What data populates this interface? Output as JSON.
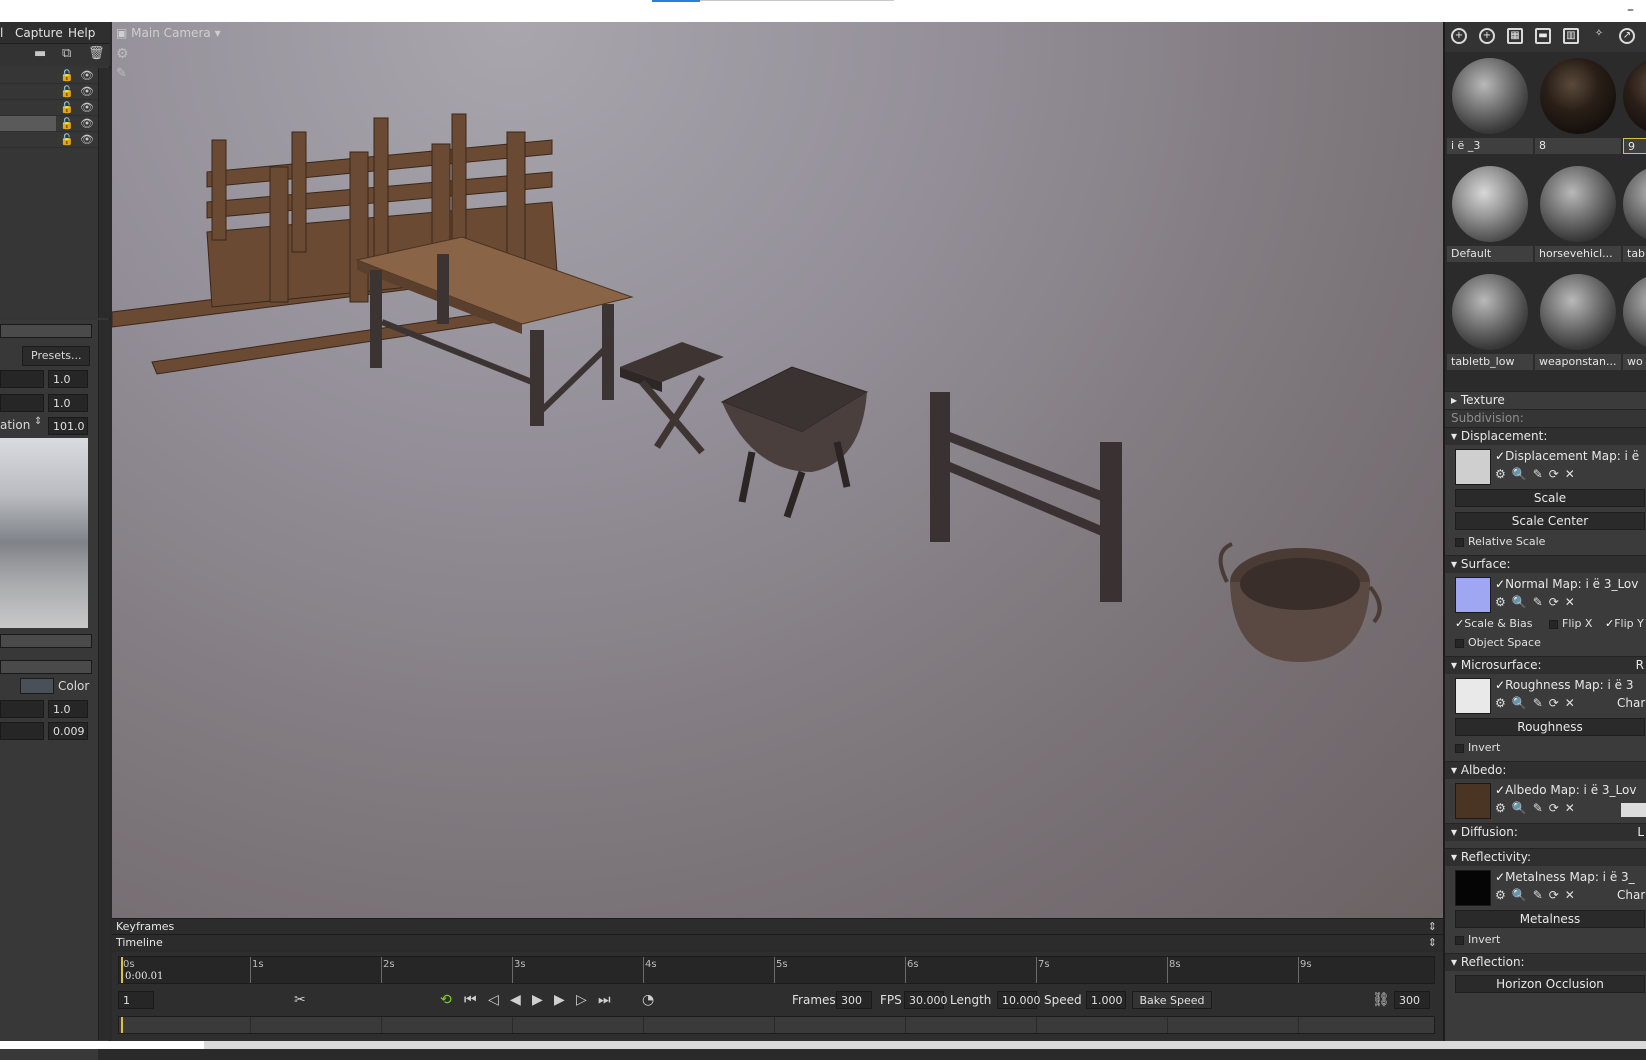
{
  "menubar": {
    "items": [
      "l",
      "Capture",
      "Help"
    ]
  },
  "left_panel": {
    "presets_label": "Presets...",
    "field_1": "1.0",
    "field_2": "1.0",
    "rotation_label": "ation",
    "rotation_value": "101.0",
    "color_label": "Color",
    "field_3": "1.0",
    "field_4": "0.009"
  },
  "viewport": {
    "camera_label": "Main Camera"
  },
  "keyframes_label": "Keyframes",
  "timeline_label": "Timeline",
  "timeline": {
    "ticks": [
      "0s",
      "1s",
      "2s",
      "3s",
      "4s",
      "5s",
      "6s",
      "7s",
      "8s",
      "9s"
    ],
    "current_time": "0:00.01",
    "frame_field": "1",
    "frames_label": "Frames",
    "frames_value": "300",
    "fps_label": "FPS",
    "fps_value": "30.000",
    "length_label": "Length",
    "length_value": "10.000",
    "speed_label": "Speed",
    "speed_value": "1.000",
    "bake_speed_label": "Bake Speed",
    "end_frame_value": "300"
  },
  "materials": [
    {
      "name": "i   ё   _3"
    },
    {
      "name": "8"
    },
    {
      "name": "9"
    },
    {
      "name": "Default"
    },
    {
      "name": "horsevehicl..."
    },
    {
      "name": "tab"
    },
    {
      "name": "tabletb_low"
    },
    {
      "name": "weaponstan..."
    },
    {
      "name": "wo"
    }
  ],
  "material_props": {
    "texture": "Texture",
    "subdivision": "Subdivision:",
    "displacement": "Displacement:",
    "displacement_map": "Displacement Map:  i      ё",
    "scale": "Scale",
    "scale_center": "Scale Center",
    "relative_scale": "Relative Scale",
    "surface": "Surface:",
    "normal_map": "Normal Map:  i      ё      3_Lov",
    "scale_bias": "Scale & Bias",
    "flip_x": "Flip X",
    "flip_y": "Flip Y",
    "object_space": "Object Space",
    "microsurface": "Microsurface:",
    "microsurface_right": "R",
    "roughness_map": "Roughness Map:  i      ё      3",
    "roughness_channel": "Char",
    "roughness": "Roughness",
    "invert_1": "Invert",
    "albedo": "Albedo:",
    "albedo_map": "Albedo Map:  i      ё      3_Lov",
    "diffusion": "Diffusion:",
    "diffusion_right": "L",
    "reflectivity": "Reflectivity:",
    "metalness_map": "Metalness Map:  i      ё      3_",
    "metalness_channel": "Char",
    "metalness": "Metalness",
    "invert_2": "Invert",
    "reflection": "Reflection:",
    "horizon_occlusion": "Horizon Occlusion"
  },
  "colors": {
    "accent_yellow": "#e0c040",
    "check_green": "#6cc644",
    "ui_dark": "#2a2a2a"
  }
}
